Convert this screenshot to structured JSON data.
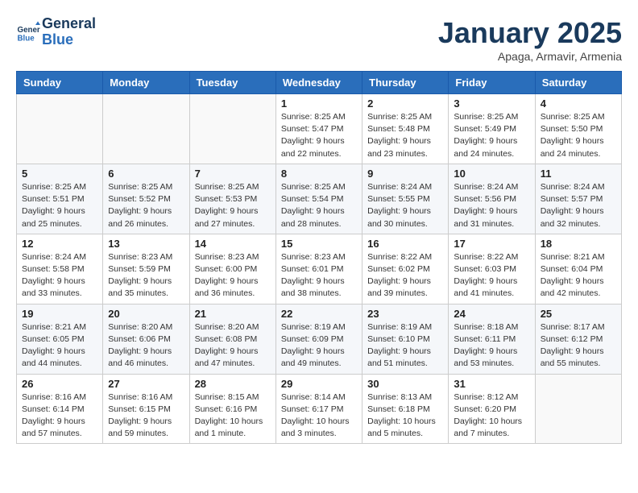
{
  "header": {
    "logo_line1": "General",
    "logo_line2": "Blue",
    "month_title": "January 2025",
    "subtitle": "Apaga, Armavir, Armenia"
  },
  "weekdays": [
    "Sunday",
    "Monday",
    "Tuesday",
    "Wednesday",
    "Thursday",
    "Friday",
    "Saturday"
  ],
  "weeks": [
    [
      {
        "day": "",
        "info": ""
      },
      {
        "day": "",
        "info": ""
      },
      {
        "day": "",
        "info": ""
      },
      {
        "day": "1",
        "info": "Sunrise: 8:25 AM\nSunset: 5:47 PM\nDaylight: 9 hours\nand 22 minutes."
      },
      {
        "day": "2",
        "info": "Sunrise: 8:25 AM\nSunset: 5:48 PM\nDaylight: 9 hours\nand 23 minutes."
      },
      {
        "day": "3",
        "info": "Sunrise: 8:25 AM\nSunset: 5:49 PM\nDaylight: 9 hours\nand 24 minutes."
      },
      {
        "day": "4",
        "info": "Sunrise: 8:25 AM\nSunset: 5:50 PM\nDaylight: 9 hours\nand 24 minutes."
      }
    ],
    [
      {
        "day": "5",
        "info": "Sunrise: 8:25 AM\nSunset: 5:51 PM\nDaylight: 9 hours\nand 25 minutes."
      },
      {
        "day": "6",
        "info": "Sunrise: 8:25 AM\nSunset: 5:52 PM\nDaylight: 9 hours\nand 26 minutes."
      },
      {
        "day": "7",
        "info": "Sunrise: 8:25 AM\nSunset: 5:53 PM\nDaylight: 9 hours\nand 27 minutes."
      },
      {
        "day": "8",
        "info": "Sunrise: 8:25 AM\nSunset: 5:54 PM\nDaylight: 9 hours\nand 28 minutes."
      },
      {
        "day": "9",
        "info": "Sunrise: 8:24 AM\nSunset: 5:55 PM\nDaylight: 9 hours\nand 30 minutes."
      },
      {
        "day": "10",
        "info": "Sunrise: 8:24 AM\nSunset: 5:56 PM\nDaylight: 9 hours\nand 31 minutes."
      },
      {
        "day": "11",
        "info": "Sunrise: 8:24 AM\nSunset: 5:57 PM\nDaylight: 9 hours\nand 32 minutes."
      }
    ],
    [
      {
        "day": "12",
        "info": "Sunrise: 8:24 AM\nSunset: 5:58 PM\nDaylight: 9 hours\nand 33 minutes."
      },
      {
        "day": "13",
        "info": "Sunrise: 8:23 AM\nSunset: 5:59 PM\nDaylight: 9 hours\nand 35 minutes."
      },
      {
        "day": "14",
        "info": "Sunrise: 8:23 AM\nSunset: 6:00 PM\nDaylight: 9 hours\nand 36 minutes."
      },
      {
        "day": "15",
        "info": "Sunrise: 8:23 AM\nSunset: 6:01 PM\nDaylight: 9 hours\nand 38 minutes."
      },
      {
        "day": "16",
        "info": "Sunrise: 8:22 AM\nSunset: 6:02 PM\nDaylight: 9 hours\nand 39 minutes."
      },
      {
        "day": "17",
        "info": "Sunrise: 8:22 AM\nSunset: 6:03 PM\nDaylight: 9 hours\nand 41 minutes."
      },
      {
        "day": "18",
        "info": "Sunrise: 8:21 AM\nSunset: 6:04 PM\nDaylight: 9 hours\nand 42 minutes."
      }
    ],
    [
      {
        "day": "19",
        "info": "Sunrise: 8:21 AM\nSunset: 6:05 PM\nDaylight: 9 hours\nand 44 minutes."
      },
      {
        "day": "20",
        "info": "Sunrise: 8:20 AM\nSunset: 6:06 PM\nDaylight: 9 hours\nand 46 minutes."
      },
      {
        "day": "21",
        "info": "Sunrise: 8:20 AM\nSunset: 6:08 PM\nDaylight: 9 hours\nand 47 minutes."
      },
      {
        "day": "22",
        "info": "Sunrise: 8:19 AM\nSunset: 6:09 PM\nDaylight: 9 hours\nand 49 minutes."
      },
      {
        "day": "23",
        "info": "Sunrise: 8:19 AM\nSunset: 6:10 PM\nDaylight: 9 hours\nand 51 minutes."
      },
      {
        "day": "24",
        "info": "Sunrise: 8:18 AM\nSunset: 6:11 PM\nDaylight: 9 hours\nand 53 minutes."
      },
      {
        "day": "25",
        "info": "Sunrise: 8:17 AM\nSunset: 6:12 PM\nDaylight: 9 hours\nand 55 minutes."
      }
    ],
    [
      {
        "day": "26",
        "info": "Sunrise: 8:16 AM\nSunset: 6:14 PM\nDaylight: 9 hours\nand 57 minutes."
      },
      {
        "day": "27",
        "info": "Sunrise: 8:16 AM\nSunset: 6:15 PM\nDaylight: 9 hours\nand 59 minutes."
      },
      {
        "day": "28",
        "info": "Sunrise: 8:15 AM\nSunset: 6:16 PM\nDaylight: 10 hours\nand 1 minute."
      },
      {
        "day": "29",
        "info": "Sunrise: 8:14 AM\nSunset: 6:17 PM\nDaylight: 10 hours\nand 3 minutes."
      },
      {
        "day": "30",
        "info": "Sunrise: 8:13 AM\nSunset: 6:18 PM\nDaylight: 10 hours\nand 5 minutes."
      },
      {
        "day": "31",
        "info": "Sunrise: 8:12 AM\nSunset: 6:20 PM\nDaylight: 10 hours\nand 7 minutes."
      },
      {
        "day": "",
        "info": ""
      }
    ]
  ]
}
